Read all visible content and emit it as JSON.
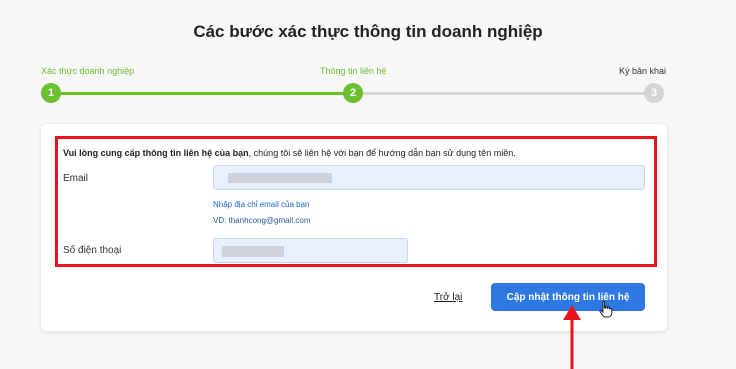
{
  "page": {
    "title": "Các bước xác thực thông tin doanh nghiệp"
  },
  "steps": [
    {
      "label": "Xác thực doanh nghiệp",
      "number": "1",
      "state": "done"
    },
    {
      "label": "Thông tin liên hệ",
      "number": "2",
      "state": "current"
    },
    {
      "label": "Ký bản khai",
      "number": "3",
      "state": "pending"
    }
  ],
  "form": {
    "intro_bold": "Vui lòng cung cấp thông tin liên hệ của bạn",
    "intro_rest": ", chúng tôi sẽ liên hệ với bạn để hướng dẫn bạn sử dụng tên miền.",
    "email_label": "Email",
    "email_hint": "Nhập địa chỉ email của bạn",
    "email_example": "VD: thanhcong@gmail.com",
    "phone_label": "Số điện thoại"
  },
  "actions": {
    "back_label": "Trở lại",
    "submit_label": "Cập nhật thông tin liên hệ"
  },
  "colors": {
    "accent_green": "#6cbf2e",
    "primary_blue": "#2f78e2",
    "highlight_red": "#e8141c",
    "inactive_gray": "#d5d5d5"
  }
}
